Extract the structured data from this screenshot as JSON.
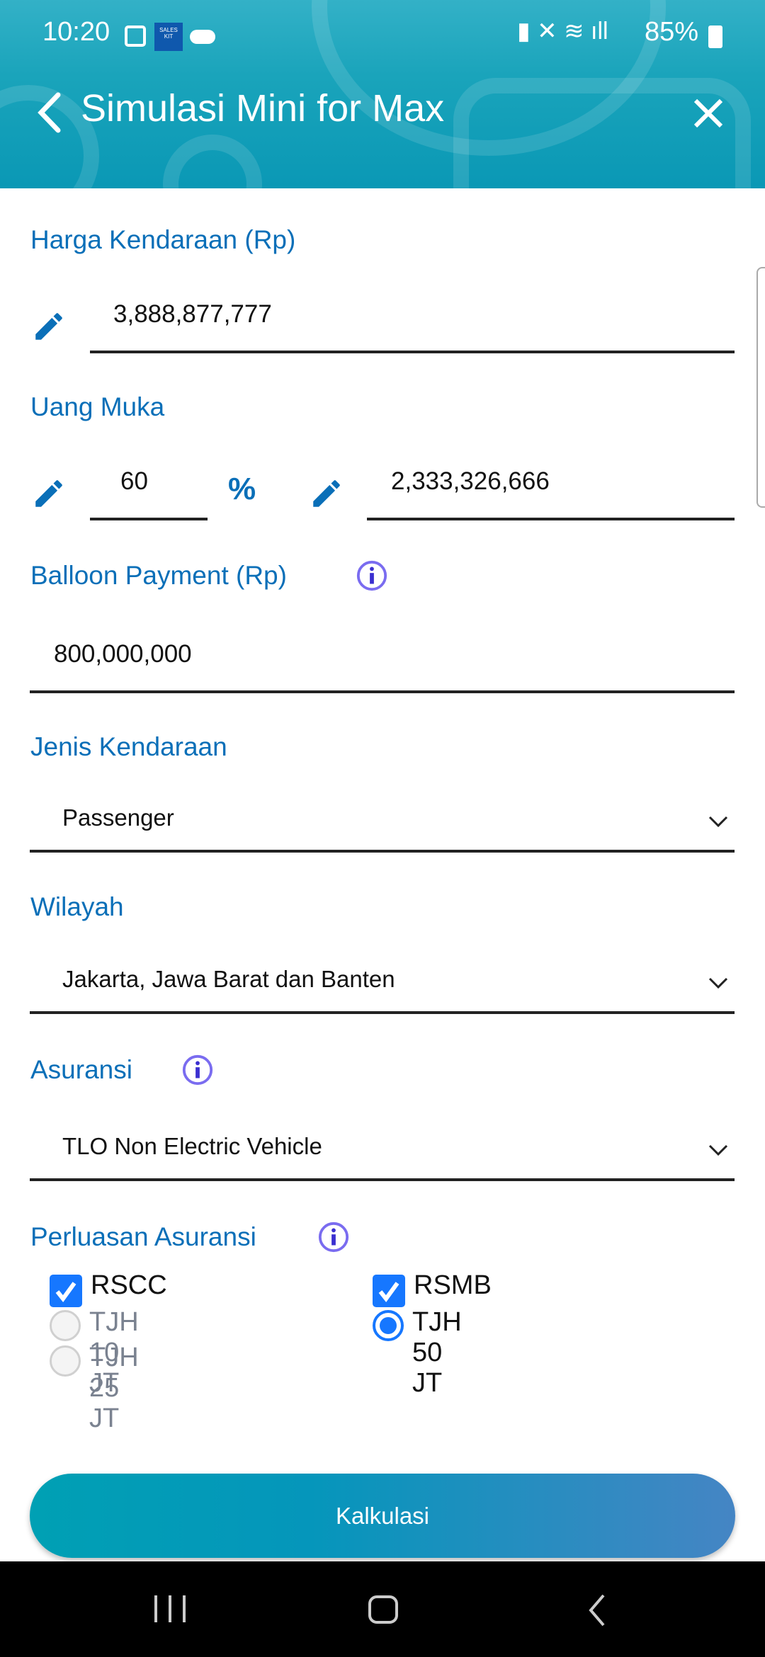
{
  "status_bar": {
    "time": "10:20",
    "battery": "85%",
    "notification_app": "SALES KIT"
  },
  "header": {
    "title": "Simulasi Mini for Max"
  },
  "form": {
    "harga": {
      "label": "Harga Kendaraan (Rp)",
      "value": "3,888,877,777"
    },
    "uang_muka": {
      "label": "Uang Muka",
      "percent": "60",
      "percent_symbol": "%",
      "amount": "2,333,326,666"
    },
    "balloon": {
      "label": "Balloon Payment (Rp)",
      "value": "800,000,000"
    },
    "jenis": {
      "label": "Jenis Kendaraan",
      "value": "Passenger"
    },
    "wilayah": {
      "label": "Wilayah",
      "value": "Jakarta, Jawa Barat dan Banten"
    },
    "asuransi": {
      "label": "Asuransi",
      "value": "TLO Non Electric Vehicle"
    },
    "perluasan": {
      "label": "Perluasan Asuransi",
      "rscc": "RSCC",
      "rsmb": "RSMB",
      "tjh10": "TJH 10 JT",
      "tjh25": "TJH 25 JT",
      "tjh50": "TJH 50 JT"
    }
  },
  "button": {
    "label": "Kalkulasi"
  },
  "colors": {
    "accent": "#0a6fb8",
    "check": "#1677ff",
    "header": "#1aa4bb"
  }
}
